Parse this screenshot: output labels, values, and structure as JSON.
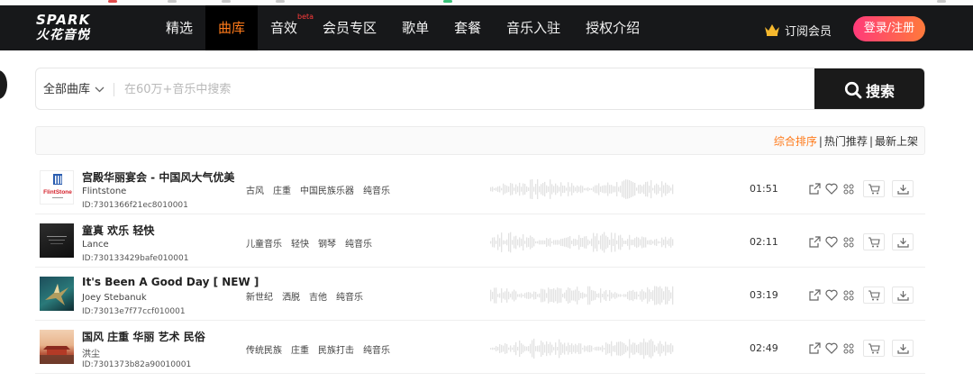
{
  "header": {
    "logo_line1": "SPARK",
    "logo_line2": "火花音悦",
    "nav": [
      {
        "label": "精选",
        "active": false
      },
      {
        "label": "曲库",
        "active": true
      },
      {
        "label": "音效",
        "active": false,
        "badge": "beta"
      },
      {
        "label": "会员专区",
        "active": false
      },
      {
        "label": "歌单",
        "active": false
      },
      {
        "label": "套餐",
        "active": false
      },
      {
        "label": "音乐入驻",
        "active": false
      },
      {
        "label": "授权介绍",
        "active": false
      }
    ],
    "subscribe_label": "订阅会员",
    "login_label": "登录/注册"
  },
  "search": {
    "library_label": "全部曲库",
    "placeholder": "在60万+音乐中搜索",
    "button_label": "搜索"
  },
  "sort": {
    "options": [
      "综合排序",
      "热门推荐",
      "最新上架"
    ],
    "active_index": 0
  },
  "tracks": [
    {
      "title": "宫殿华丽宴会 - 中国风大气优美",
      "artist": "Flintstone",
      "id": "ID:7301366f21ec8010001",
      "tags": [
        "古风",
        "庄重",
        "中国民族乐器",
        "纯音乐"
      ],
      "duration": "01:51",
      "cover_text": "FlintStone"
    },
    {
      "title": "童真 欢乐 轻快",
      "artist": "Lance",
      "id": "ID:730133429bafe010001",
      "tags": [
        "儿童音乐",
        "轻快",
        "钢琴",
        "纯音乐"
      ],
      "duration": "02:11"
    },
    {
      "title": "It's Been A Good Day [ NEW ]",
      "artist": "Joey Stebanuk",
      "id": "ID:73013e7f77ccf010001",
      "tags": [
        "新世纪",
        "洒脱",
        "吉他",
        "纯音乐"
      ],
      "duration": "03:19"
    },
    {
      "title": "国风 庄重 华丽 艺术 民俗",
      "artist": "洪尘",
      "id": "ID:7301373b82a90010001",
      "tags": [
        "传统民族",
        "庄重",
        "民族打击",
        "纯音乐"
      ],
      "duration": "02:49"
    }
  ],
  "colors": {
    "header_bg": "#17181a",
    "accent": "#ff7a1a",
    "login_gradient_start": "#ff3a7a",
    "login_gradient_end": "#ff7a3a",
    "search_button_bg": "#1a1a1a",
    "crown": "#f5b82e"
  },
  "icons": {
    "track_actions": [
      "share-icon",
      "heart-icon",
      "similar-icon",
      "cart-icon",
      "download-icon"
    ]
  }
}
